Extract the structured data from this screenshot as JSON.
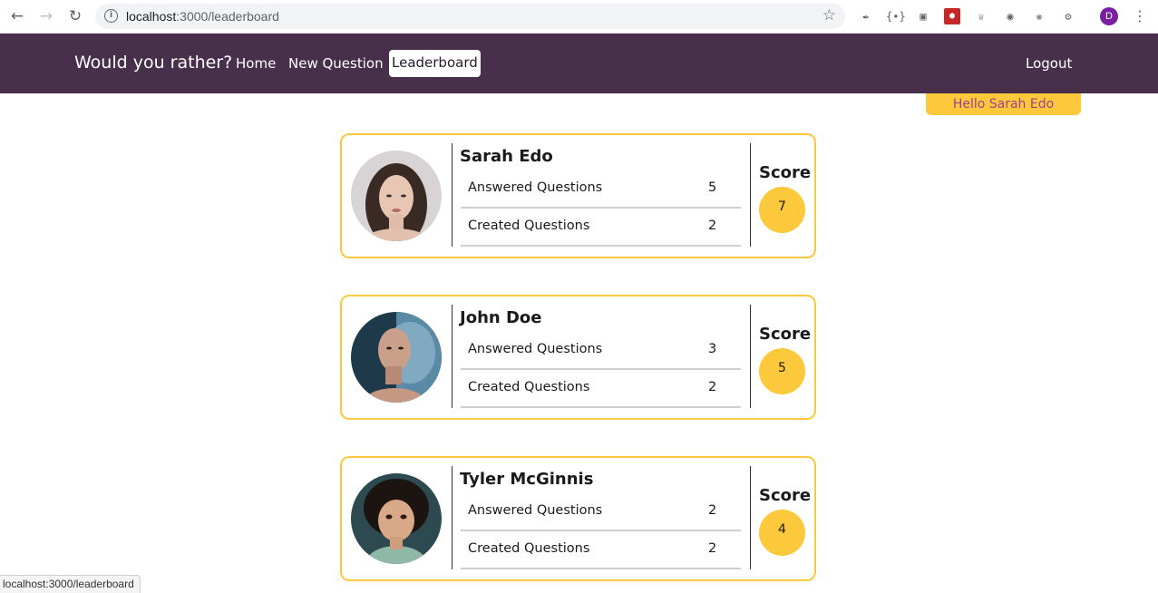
{
  "browser": {
    "url_host": "localhost",
    "url_path": ":3000/leaderboard",
    "profile_initial": "D",
    "status_url": "localhost:3000/leaderboard"
  },
  "navbar": {
    "brand": "Would you rather?",
    "links": [
      {
        "label": "Home"
      },
      {
        "label": "New Question"
      },
      {
        "label": "Leaderboard"
      }
    ],
    "logout": "Logout",
    "greeting": "Hello Sarah Edo"
  },
  "leaderboard": [
    {
      "name": "Sarah Edo",
      "answered_label": "Answered Questions",
      "answered": "5",
      "created_label": "Created Questions",
      "created": "2",
      "score_label": "Score",
      "score": "7"
    },
    {
      "name": "John Doe",
      "answered_label": "Answered Questions",
      "answered": "3",
      "created_label": "Created Questions",
      "created": "2",
      "score_label": "Score",
      "score": "5"
    },
    {
      "name": "Tyler McGinnis",
      "answered_label": "Answered Questions",
      "answered": "2",
      "created_label": "Created Questions",
      "created": "2",
      "score_label": "Score",
      "score": "4"
    }
  ],
  "colors": {
    "navbar": "#48304d",
    "accent": "#fcc93c",
    "greeting_text": "#a4408a"
  }
}
